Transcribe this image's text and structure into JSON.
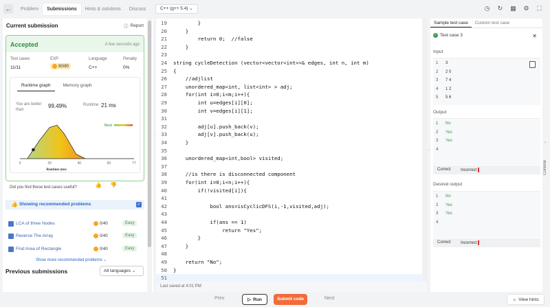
{
  "topbar": {
    "tabs": [
      {
        "label": "Problem"
      },
      {
        "label": "Submissions"
      },
      {
        "label": "Hints & solutions"
      },
      {
        "label": "Discuss"
      }
    ],
    "language": "C++ (g++ 5.4)"
  },
  "submission": {
    "header": "Current submission",
    "report": "Report",
    "status": "Accepted",
    "time_ago": "A few seconds ago",
    "stats": {
      "test_cases_label": "Test cases",
      "test_cases": "11/11",
      "exp_label": "EXP",
      "exp": "80/80",
      "language_label": "Language",
      "language": "C++",
      "penalty_label": "Penalty",
      "penalty": "0%"
    },
    "graph_tabs": [
      "Runtime graph",
      "Memory graph"
    ],
    "better_than_label": "You are better than",
    "better_than": "99.49%",
    "runtime_label": "Runtime",
    "runtime": "21 ms",
    "best_label": "Best",
    "feedback": "Did you find these test cases useful?"
  },
  "chart_data": {
    "type": "area",
    "x_ticks": [
      "0",
      "20",
      "40",
      "60",
      "77"
    ],
    "xlabel": "Runtime (ms)",
    "xlim": [
      0,
      77
    ],
    "x": [
      0,
      5,
      9,
      13,
      20,
      25,
      30,
      38,
      44,
      50,
      77
    ],
    "y": [
      0,
      0,
      8,
      16,
      28,
      30,
      22,
      4,
      0,
      0,
      0
    ],
    "marker": {
      "x": 9,
      "y": 8
    },
    "legend": "top-right"
  },
  "recommended": {
    "header": "Showing recommended problems",
    "items": [
      {
        "name": "LCA of three Nodes",
        "exp": "0/40",
        "difficulty": "Easy"
      },
      {
        "name": "Reverse The Array",
        "exp": "0/40",
        "difficulty": "Easy"
      },
      {
        "name": "Find Area of Rectangle",
        "exp": "0/40",
        "difficulty": "Easy"
      }
    ],
    "show_more": "Show more recommended problems"
  },
  "previous": {
    "header": "Previous submissions",
    "filter": "All languages"
  },
  "editor": {
    "lines": [
      {
        "n": "19",
        "c": "        }"
      },
      {
        "n": "20",
        "c": "    }"
      },
      {
        "n": "21",
        "c": "        return 0;  //false"
      },
      {
        "n": "22",
        "c": "    }"
      },
      {
        "n": "23",
        "c": ""
      },
      {
        "n": "24",
        "c": "string cycleDetection (vector<vector<int>>& edges, int n, int m)"
      },
      {
        "n": "25",
        "c": "{"
      },
      {
        "n": "26",
        "c": "    //adjlist"
      },
      {
        "n": "27",
        "c": "    unordered_map<int, list<int> > adj;"
      },
      {
        "n": "28",
        "c": "    for(int i=0;i<m;i++){"
      },
      {
        "n": "29",
        "c": "        int u=edges[i][0];"
      },
      {
        "n": "30",
        "c": "        int v=edges[i][1];"
      },
      {
        "n": "31",
        "c": ""
      },
      {
        "n": "32",
        "c": "        adj[u].push_back(v);"
      },
      {
        "n": "33",
        "c": "        adj[v].push_back(u);"
      },
      {
        "n": "34",
        "c": "    }"
      },
      {
        "n": "35",
        "c": ""
      },
      {
        "n": "36",
        "c": "    unordered_map<int,bool> visited;"
      },
      {
        "n": "37",
        "c": ""
      },
      {
        "n": "38",
        "c": "    //is there is disconnected component"
      },
      {
        "n": "39",
        "c": "    for(int i=0;i<n;i++){"
      },
      {
        "n": "40",
        "c": "        if(!visited[i]){"
      },
      {
        "n": "41",
        "c": ""
      },
      {
        "n": "42",
        "c": "            bool ans=isCyclicDFS(i,-1,visited,adj);"
      },
      {
        "n": "43",
        "c": ""
      },
      {
        "n": "44",
        "c": "            if(ans == 1)"
      },
      {
        "n": "45",
        "c": "                return \"Yes\";"
      },
      {
        "n": "46",
        "c": "        }"
      },
      {
        "n": "47",
        "c": "    }"
      },
      {
        "n": "48",
        "c": ""
      },
      {
        "n": "49",
        "c": "    return \"No\";"
      },
      {
        "n": "50",
        "c": "}"
      },
      {
        "n": "51",
        "c": ""
      }
    ],
    "saved": "Last saved at 4:01 PM"
  },
  "testpanel": {
    "tabs": [
      "Sample test case",
      "Custom test case"
    ],
    "case_label": "Test case 3",
    "input_label": "Input",
    "input": [
      {
        "n": "1",
        "v": "3"
      },
      {
        "n": "2",
        "v": "2 0"
      },
      {
        "n": "3",
        "v": "7 4"
      },
      {
        "n": "4",
        "v": "1 2"
      },
      {
        "n": "5",
        "v": "5 6"
      }
    ],
    "output_label": "Output",
    "output": [
      {
        "n": "1",
        "v": "No"
      },
      {
        "n": "2",
        "v": "Yes"
      },
      {
        "n": "3",
        "v": "Yes"
      },
      {
        "n": "4",
        "v": ""
      }
    ],
    "desired_label": "Desired output",
    "desired": [
      {
        "n": "1",
        "v": "No"
      },
      {
        "n": "2",
        "v": "Yes"
      },
      {
        "n": "3",
        "v": "Yes"
      },
      {
        "n": "4",
        "v": ""
      }
    ],
    "correct": "Correct",
    "incorrect": "Incorrect",
    "console": "Console"
  },
  "bottombar": {
    "prev": "Prev",
    "run": "Run",
    "submit": "Submit code",
    "next": "Next",
    "hints": "View hints"
  },
  "colors": {
    "accent": "#f26b38",
    "success": "#2e8b3e",
    "link": "#2b64c7",
    "incorrect": "#e03131"
  }
}
